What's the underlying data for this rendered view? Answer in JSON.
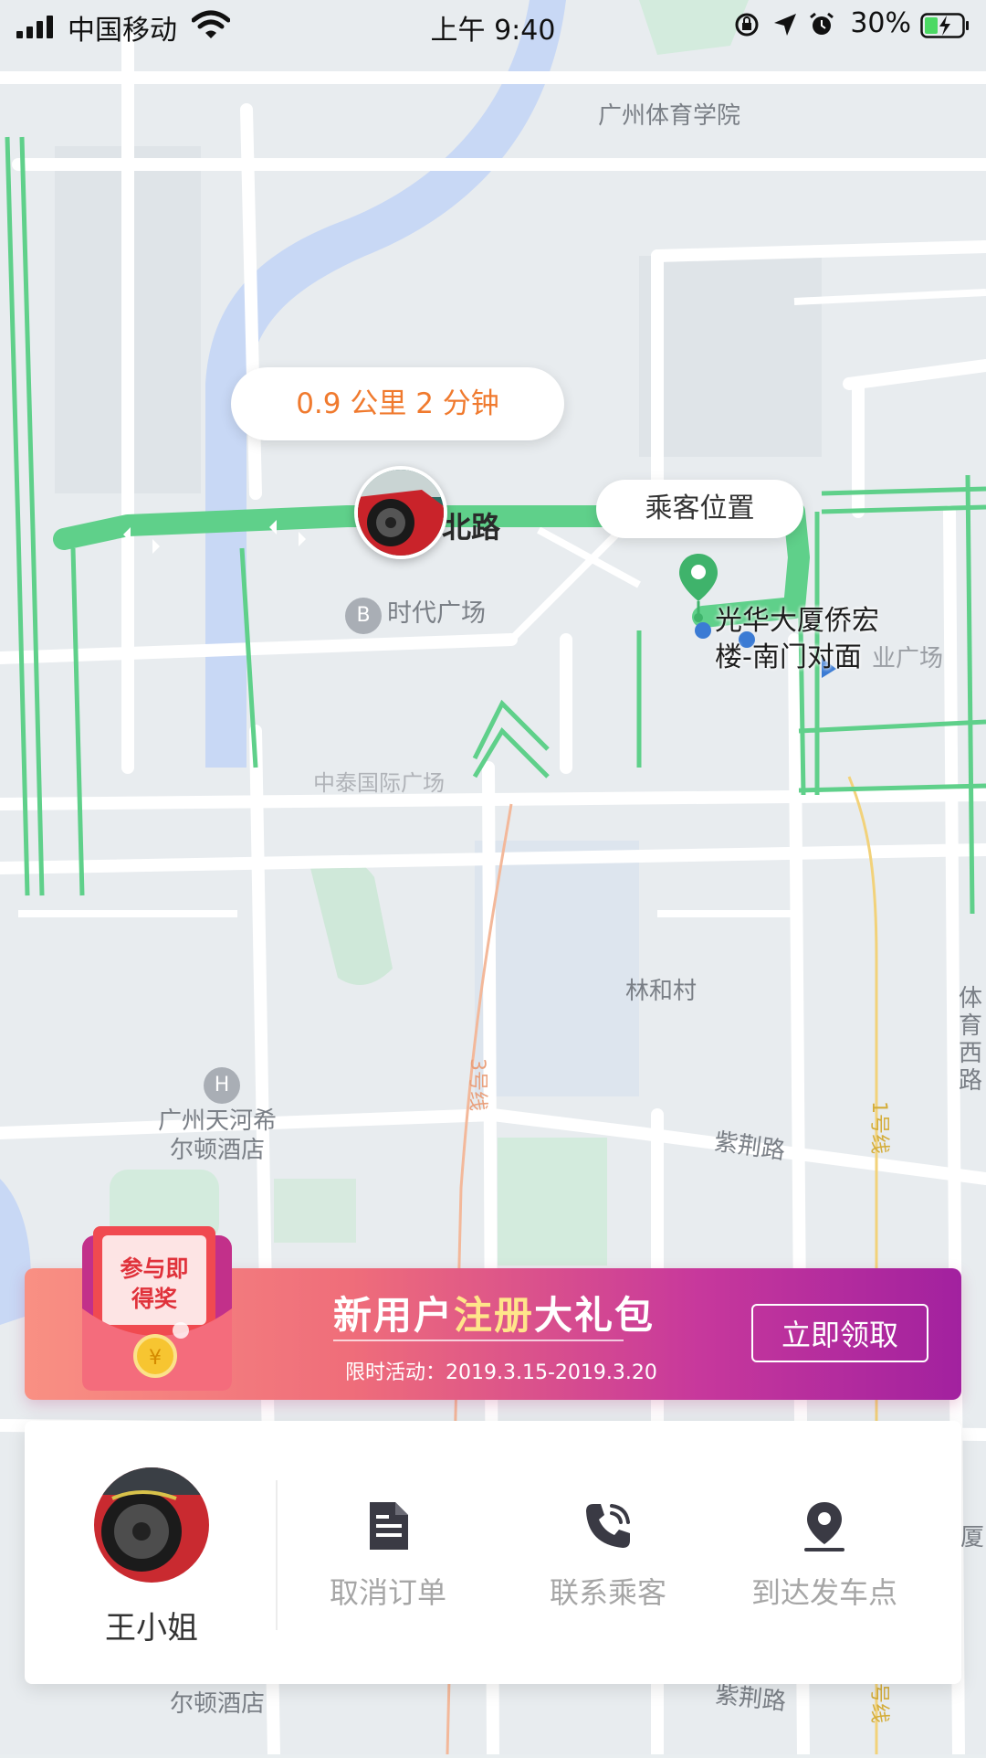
{
  "status_bar": {
    "carrier": "中国移动",
    "time": "上午 9:40",
    "battery": "30%"
  },
  "map": {
    "labels": {
      "sports_college": "广州体育学院",
      "times_square": "时代广场",
      "road_north": "北路",
      "zhongtai": "中泰国际广场",
      "linhe_village": "林和村",
      "hilton_line1": "广州天河希",
      "hilton_line2": "尔顿酒店",
      "hilton_bottom": "尔顿酒店",
      "line3": "3号线",
      "zijing_road": "紫荆路",
      "zijing_road_bottom": "紫荆路",
      "line1": "1号线",
      "line_bottom": "号线",
      "tiyu_west": "体育西路",
      "industry_plaza": "业广场",
      "edge_right": "厦"
    }
  },
  "eta_bubble": {
    "distance": "0.9 公里",
    "duration": "2 分钟"
  },
  "passenger_location_label": "乘客位置",
  "pickup_point": {
    "line1": "光华大厦侨宏",
    "line2": "楼-南门对面"
  },
  "promo": {
    "graphic_text_line1": "参与即",
    "graphic_text_line2": "得奖",
    "title_part1": "新用户",
    "title_highlight": "注册",
    "title_part2": "大礼包",
    "subtitle": "限时活动：2019.3.15-2019.3.20",
    "button": "立即领取"
  },
  "action_card": {
    "passenger_name": "王小姐",
    "actions": [
      {
        "label": "取消订单",
        "icon": "document-icon"
      },
      {
        "label": "联系乘客",
        "icon": "phone-icon"
      },
      {
        "label": "到达发车点",
        "icon": "location-pin-icon"
      }
    ]
  },
  "colors": {
    "route_green": "#5fd08a",
    "eta_orange": "#f07a2e",
    "promo_start": "#f99083",
    "promo_end": "#a2219f",
    "highlight_yellow": "#ffe58a"
  }
}
